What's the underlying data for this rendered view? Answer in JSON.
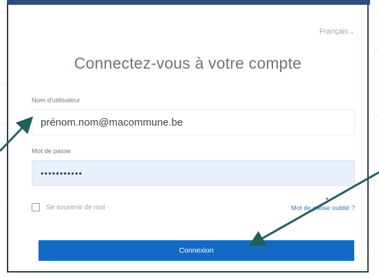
{
  "header": {
    "language": "Français",
    "title": "Connectez-vous à votre compte"
  },
  "form": {
    "username_label": "Nom d'utilisateur",
    "username_value": "prénom.nom@macommune.be",
    "password_label": "Mot de passe",
    "password_value": "•••••••••••",
    "remember_label": "Se souvenir de moi",
    "forgot_label": "Mot de passe oublié ?",
    "submit_label": "Connexion"
  },
  "colors": {
    "button": "#1469c7",
    "link": "#3a72c0",
    "arrow": "#1f5f5c",
    "password_bg": "#e9effb"
  },
  "icons": {
    "language_chevron": "chevron-down-icon",
    "arrow_to_username": "annotation-arrow-icon",
    "arrow_to_submit": "annotation-arrow-icon"
  }
}
